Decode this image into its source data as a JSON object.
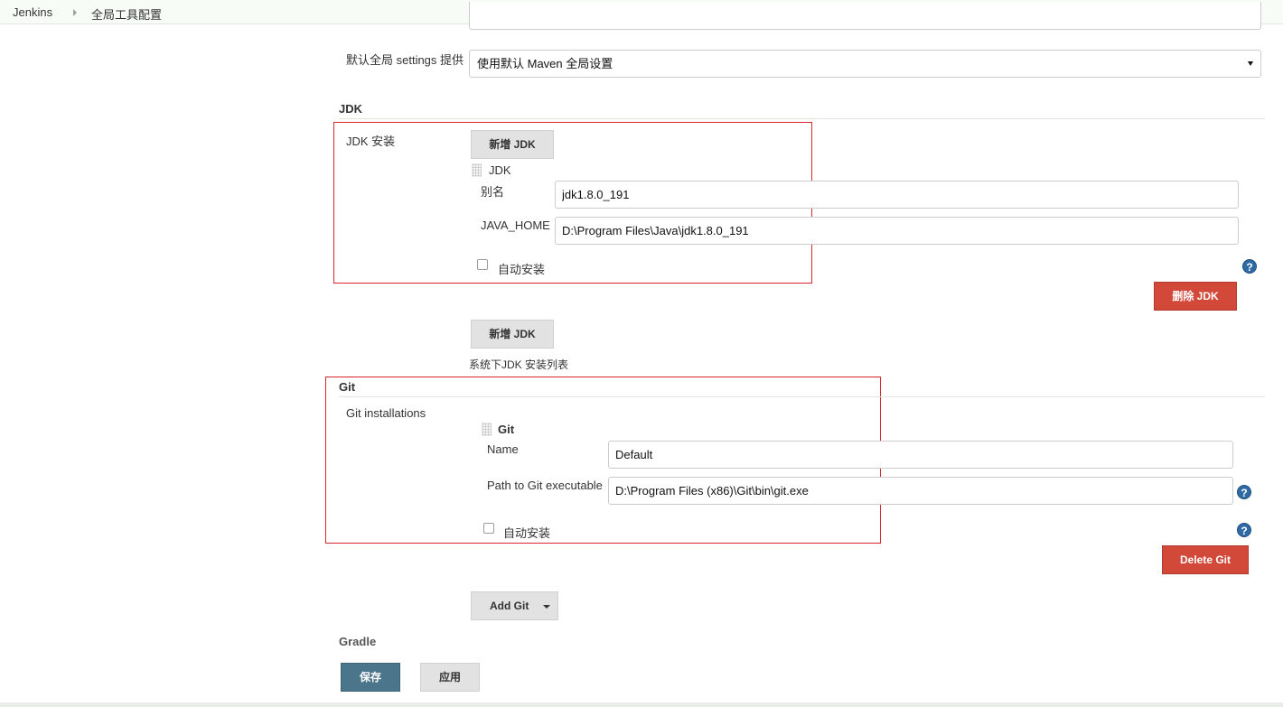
{
  "breadcrumb": {
    "items": [
      "Jenkins",
      "全局工具配置"
    ]
  },
  "maven": {
    "global_settings_label": "默认全局 settings 提供",
    "global_settings_value": "使用默认 Maven 全局设置"
  },
  "jdk": {
    "section_title": "JDK",
    "install_label": "JDK 安装",
    "add_button": "新增 JDK",
    "item_title": "JDK",
    "alias_label": "别名",
    "alias_value": "jdk1.8.0_191",
    "java_home_label": "JAVA_HOME",
    "java_home_value": "D:\\Program Files\\Java\\jdk1.8.0_191",
    "auto_install_label": "自动安装",
    "delete_button": "删除 JDK",
    "add_button_2": "新增 JDK",
    "list_caption": "系统下JDK 安装列表"
  },
  "git": {
    "section_title": "Git",
    "installations_label": "Git installations",
    "item_title": "Git",
    "name_label": "Name",
    "name_value": "Default",
    "path_label": "Path to Git executable",
    "path_value": "D:\\Program Files (x86)\\Git\\bin\\git.exe",
    "auto_install_label": "自动安装",
    "delete_button": "Delete Git",
    "add_button": "Add Git"
  },
  "gradle": {
    "section_title": "Gradle"
  },
  "footer": {
    "save_button": "保存",
    "apply_button": "应用"
  },
  "help_icon_glyph": "?",
  "colors": {
    "highlight_box": "#d9252b",
    "delete_button": "#d24939",
    "save_button": "#4b758b",
    "help_icon": "#2f6aa5"
  }
}
